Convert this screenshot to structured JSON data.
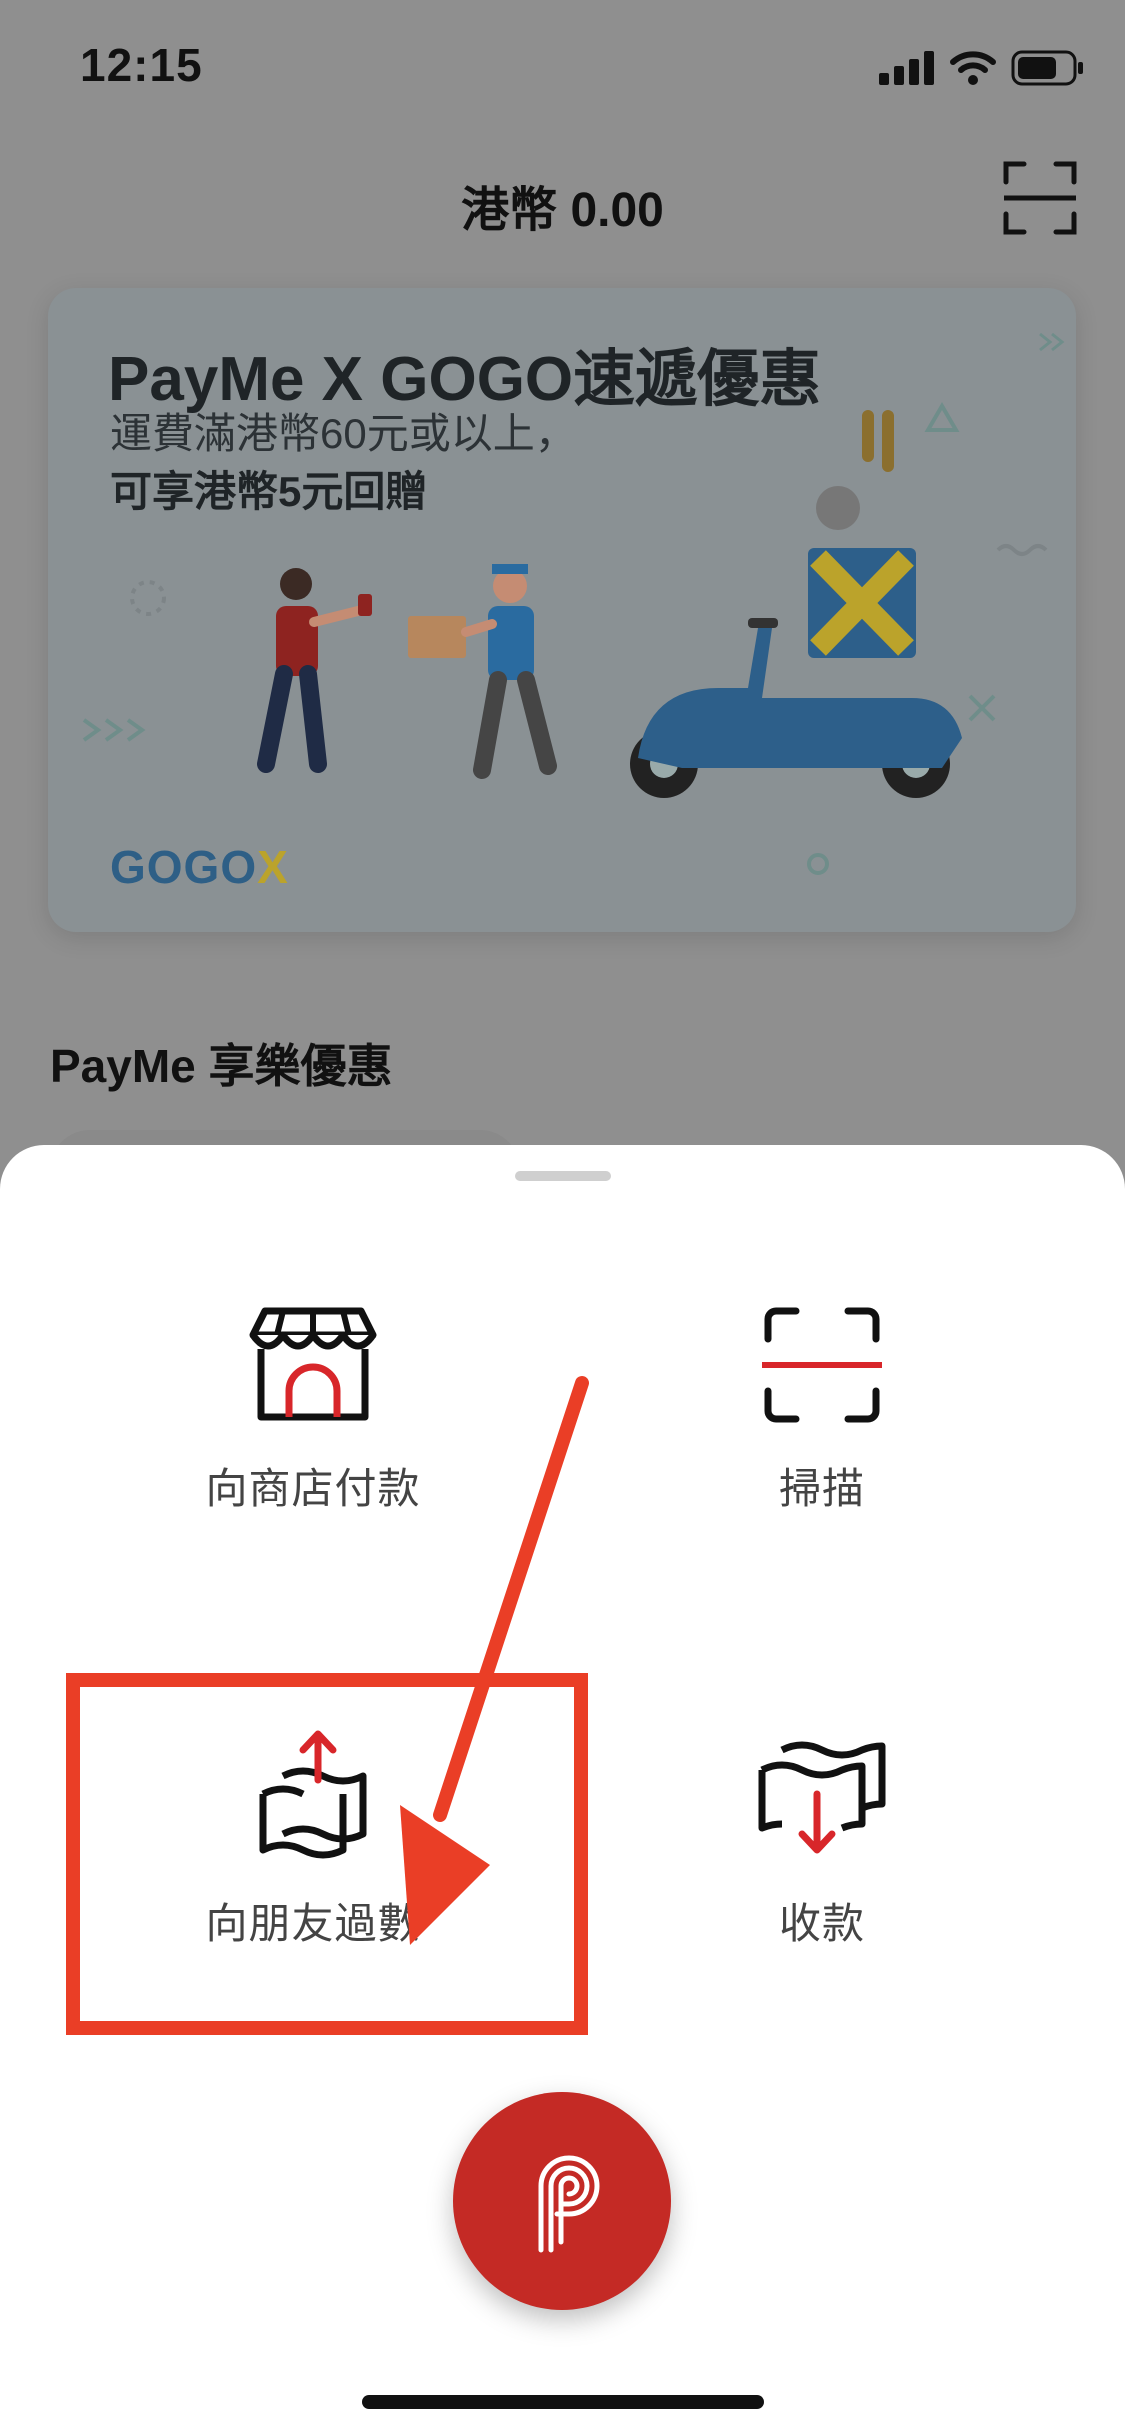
{
  "status_bar": {
    "time": "12:15",
    "icons": [
      "signal-icon",
      "wifi-icon",
      "battery-icon"
    ]
  },
  "header": {
    "balance": "港幣 0.00",
    "scan_icon": "scan-icon"
  },
  "promo": {
    "title": "PayMe X GOGO速遞優惠",
    "line1": "運費滿港幣60元或以上，",
    "line2": "可享港幣5元回贈",
    "brand_main": "GOGO",
    "brand_x": "X"
  },
  "section": {
    "title": "PayMe 享樂優惠"
  },
  "sheet": {
    "actions": [
      {
        "label": "向商店付款",
        "icon": "storefront-icon"
      },
      {
        "label": "掃描",
        "icon": "scan-icon"
      },
      {
        "label": "向朋友過數",
        "icon": "send-money-icon"
      },
      {
        "label": "收款",
        "icon": "receive-money-icon"
      }
    ],
    "fab_icon": "payme-logo-icon"
  },
  "annotation": {
    "highlight_color": "#ea3e26",
    "arrow_color": "#ea3e26"
  },
  "colors": {
    "brand_red": "#c42a25",
    "dim_overlay": "#8f8f8f"
  }
}
